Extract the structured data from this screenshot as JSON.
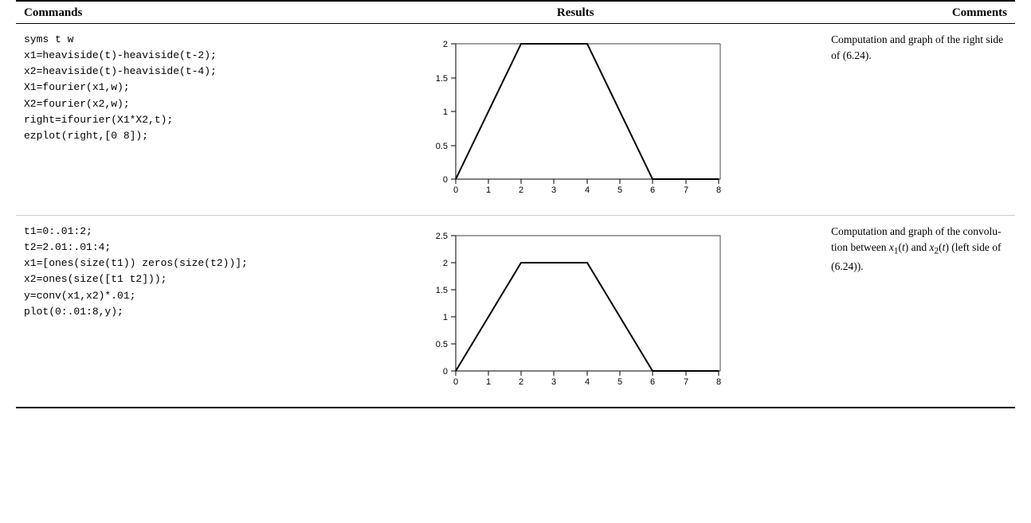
{
  "header": {
    "col1": "Commands",
    "col2": "Results",
    "col3": "Comments"
  },
  "rows": [
    {
      "id": "row1",
      "code": "syms t w\nx1=heaviside(t)-heaviside(t-2);\nx2=heaviside(t)-heaviside(t-4);\nX1=fourier(x1,w);\nX2=fourier(x2,w);\nright=ifourier(X1*X2,t);\nezplot(right,[0 8]);",
      "comment": "Computation and graph of the right side of (6.24).",
      "graph_id": "graph1"
    },
    {
      "id": "row2",
      "code": "t1=0:.01:2;\nt2=2.01:.01:4;\nx1=[ones(size(t1)) zeros(size(t2))];\nx2=ones(size([t1 t2]));\ny=conv(x1,x2)*.01;\nplot(0:.01:8,y);",
      "comment": "Computation and graph of the convolution between x₁(t) and x₂(t) (left side of (6.24)).",
      "graph_id": "graph2"
    }
  ]
}
